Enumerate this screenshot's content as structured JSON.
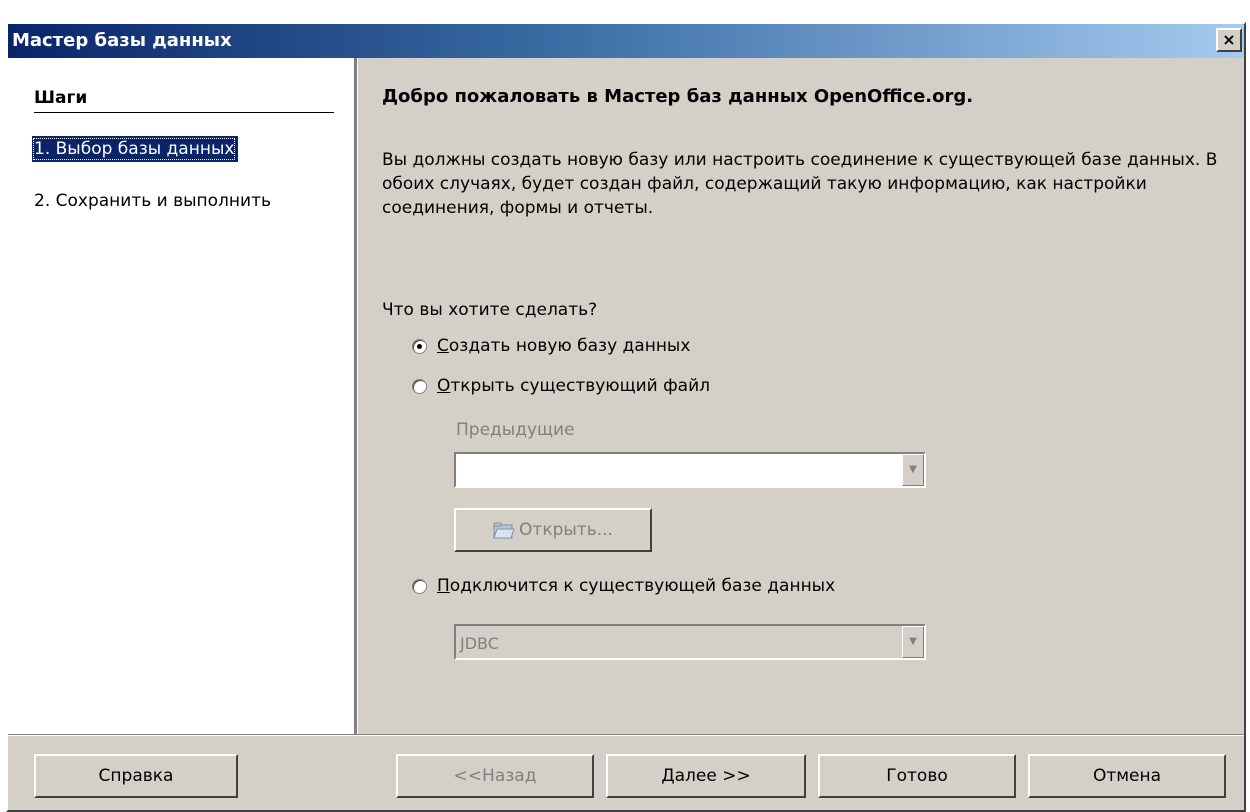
{
  "window": {
    "title": "Мастер базы данных",
    "close_symbol": "×"
  },
  "steps": {
    "title": "Шаги",
    "items": [
      {
        "label": "1.  Выбор базы данных",
        "active": true
      },
      {
        "label": "2.  Сохранить и выполнить",
        "active": false
      }
    ]
  },
  "main": {
    "heading": "Добро пожаловать в Мастер баз данных OpenOffice.org.",
    "description": "Вы должны создать новую базу или настроить соединение к существующей базе данных. В обоих случаях, будет создан файл, содержащий такую информацию, как настройки соединения, формы и отчеты.",
    "question": "Что вы хотите сделать?",
    "options": {
      "create_new": {
        "label_first": "С",
        "label_rest": "оздать новую базу данных",
        "checked": true
      },
      "open_existing": {
        "label_first": "О",
        "label_rest": "ткрыть существующий файл",
        "checked": false
      },
      "connect_existing": {
        "label_first": "П",
        "label_rest": "одключится к существующей базе данных",
        "checked": false
      }
    },
    "recent_label": "Предыдущие",
    "recent_value": "",
    "open_button": "Открыть...",
    "db_type_value": "JDBC"
  },
  "footer": {
    "help": "Справка",
    "back": "<<Назад",
    "next": "Далее >>",
    "finish": "Готово",
    "cancel": "Отмена"
  }
}
